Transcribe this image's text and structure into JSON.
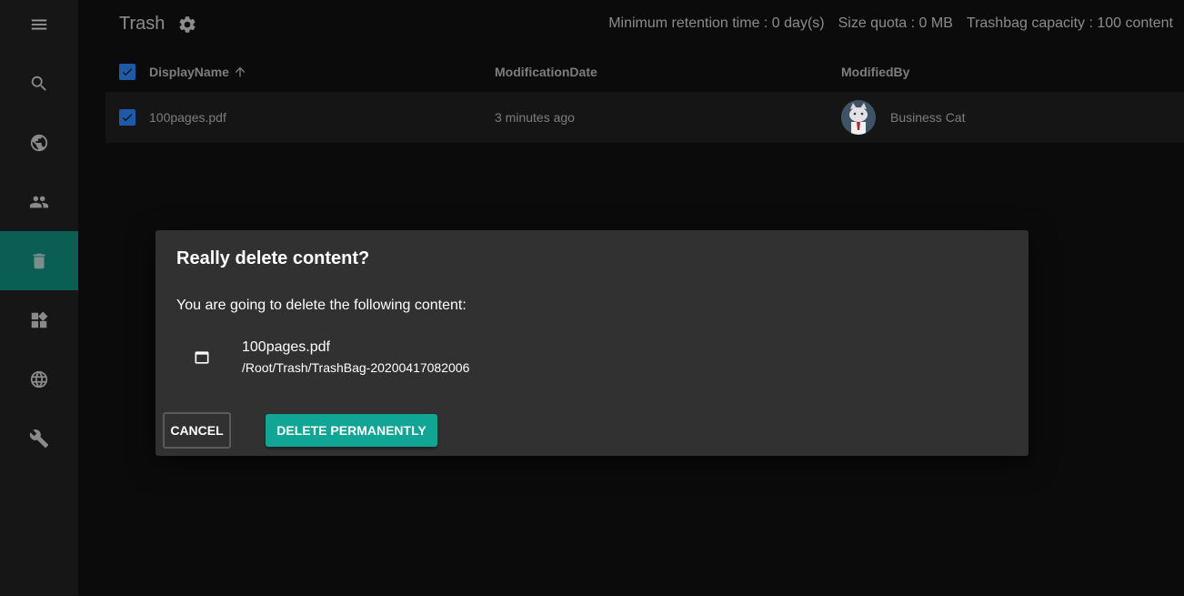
{
  "header": {
    "title": "Trash",
    "stats": [
      "Minimum retention time : 0 day(s)",
      "Size quota : 0 MB",
      "Trashbag capacity : 100 content"
    ]
  },
  "sidebar": {
    "items": [
      {
        "icon": "menu-icon"
      },
      {
        "icon": "search-icon"
      },
      {
        "icon": "globe-icon"
      },
      {
        "icon": "people-icon"
      },
      {
        "icon": "trash-icon",
        "active": true
      },
      {
        "icon": "widgets-icon"
      },
      {
        "icon": "language-icon"
      },
      {
        "icon": "wrench-icon"
      }
    ]
  },
  "table": {
    "columns": [
      "DisplayName",
      "ModificationDate",
      "ModifiedBy"
    ],
    "sort": {
      "column": "DisplayName",
      "direction": "ascending"
    },
    "rows": [
      {
        "name": "100pages.pdf",
        "date": "3 minutes ago",
        "user": "Business Cat",
        "checked": true
      }
    ]
  },
  "dialog": {
    "title": "Really delete content?",
    "message": "You are going to delete the following content:",
    "item_name": "100pages.pdf",
    "item_path": "/Root/Trash/TrashBag-20200417082006",
    "cancel_label": "CANCEL",
    "delete_label": "DELETE PERMANENTLY"
  },
  "colors": {
    "accent": "#10a594",
    "sidebar_active": "#0b5e54",
    "checkbox": "#1f5aa8"
  }
}
